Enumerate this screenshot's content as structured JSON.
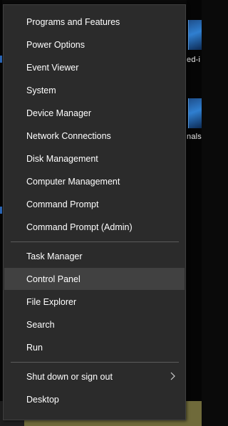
{
  "menu": {
    "items": [
      {
        "label": "Programs and Features",
        "active": false
      },
      {
        "label": "Power Options",
        "active": false
      },
      {
        "label": "Event Viewer",
        "active": false
      },
      {
        "label": "System",
        "active": false
      },
      {
        "label": "Device Manager",
        "active": false
      },
      {
        "label": "Network Connections",
        "active": false
      },
      {
        "label": "Disk Management",
        "active": false
      },
      {
        "label": "Computer Management",
        "active": false
      },
      {
        "label": "Command Prompt",
        "active": false
      },
      {
        "label": "Command Prompt (Admin)",
        "active": false
      },
      {
        "label": "Task Manager",
        "active": false
      },
      {
        "label": "Control Panel",
        "active": true
      },
      {
        "label": "File Explorer",
        "active": false
      },
      {
        "label": "Search",
        "active": false
      },
      {
        "label": "Run",
        "active": false
      },
      {
        "label": "Shut down or sign out",
        "active": false,
        "submenu": true,
        "submenu_icon": "chevron-right-icon"
      },
      {
        "label": "Desktop",
        "active": false
      }
    ]
  },
  "desktop": {
    "label_1": "ed-i",
    "label_2": "nals"
  },
  "colors": {
    "menu_background": "#2b2b2b",
    "menu_hover": "#414141",
    "menu_text": "#ffffff",
    "separator": "#5c5c5c",
    "taskbar": "#6f6a3a"
  }
}
